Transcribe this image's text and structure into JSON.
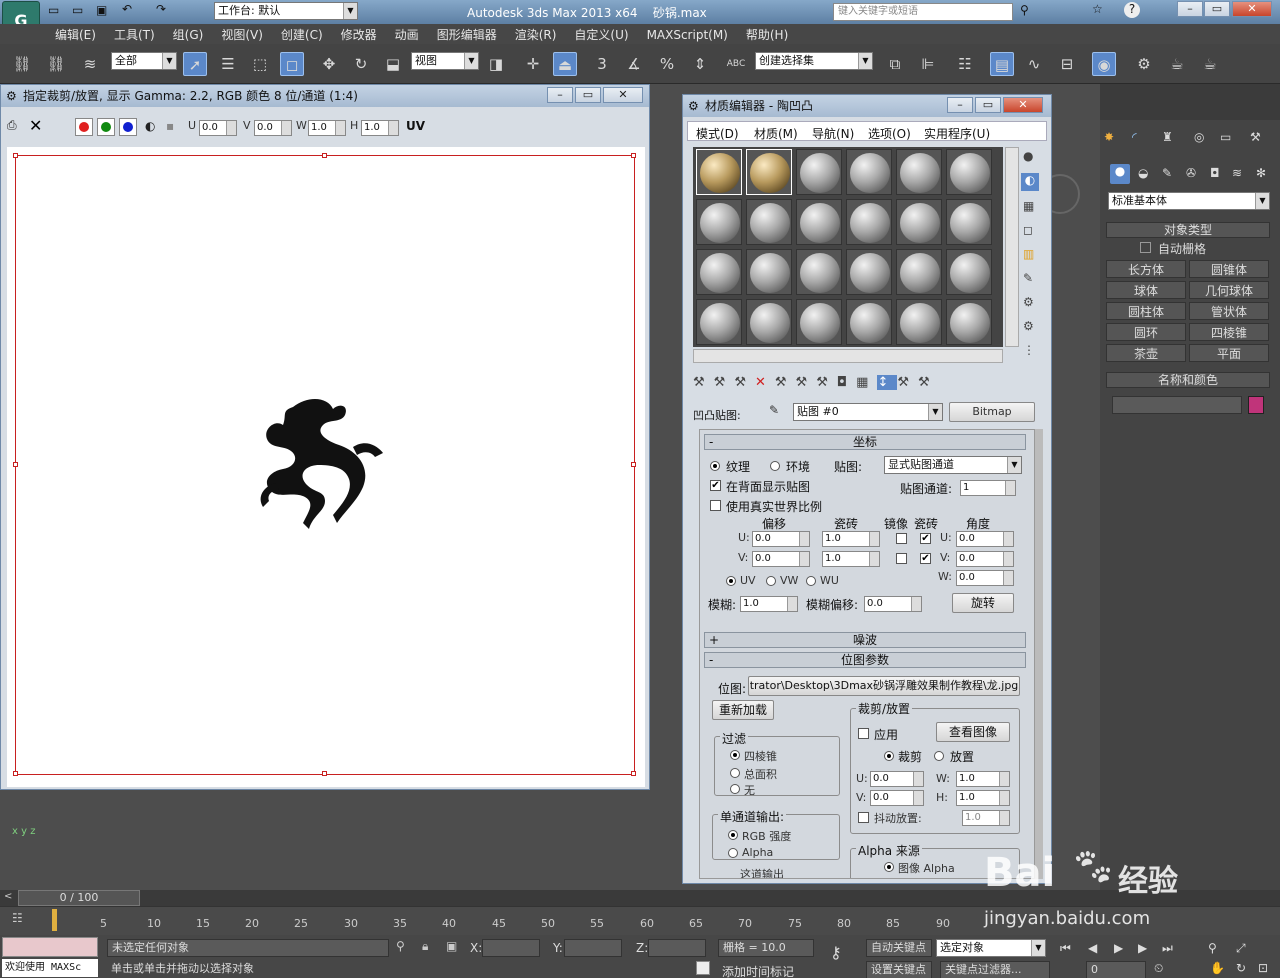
{
  "app": {
    "title": "Autodesk 3ds Max  2013 x64",
    "file": "砂锅.max",
    "workspace": "工作台: 默认",
    "search_placeholder": "键入关键字或短语"
  },
  "menu": [
    "编辑(E)",
    "工具(T)",
    "组(G)",
    "视图(V)",
    "创建(C)",
    "修改器",
    "动画",
    "图形编辑器",
    "渲染(R)",
    "自定义(U)",
    "MAXScript(M)",
    "帮助(H)"
  ],
  "toolbar": {
    "selection_filter": "全部",
    "ref_coord": "视图",
    "named_selection": "创建选择集",
    "snap3": "3",
    "snap_pct": "%",
    "abc": "ABC"
  },
  "crop_window": {
    "title": "指定裁剪/放置, 显示 Gamma: 2.2, RGB 颜色 8 位/通道 (1:4)",
    "u_label": "U",
    "u": "0.0",
    "v_label": "V",
    "v": "0.0",
    "w_label": "W",
    "w": "1.0",
    "h_label": "H",
    "h": "1.0",
    "uv_label": "UV"
  },
  "mat_editor": {
    "title": "材质编辑器 - 陶凹凸",
    "menu": [
      "模式(D)",
      "材质(M)",
      "导航(N)",
      "选项(O)",
      "实用程序(U)"
    ],
    "map_slot_label": "凹凸贴图:",
    "map_name": "贴图 #0",
    "map_type": "Bitmap",
    "coords": {
      "header": "坐标",
      "texture": "纹理",
      "env": "环境",
      "mapping_label": "贴图:",
      "mapping": "显式贴图通道",
      "show_back": "在背面显示贴图",
      "map_channel_label": "贴图通道:",
      "map_channel": "1",
      "real_world": "使用真实世界比例",
      "offset": "偏移",
      "tiling": "瓷砖",
      "mirror": "镜像",
      "tile": "瓷砖",
      "angle": "角度",
      "u": "U:",
      "v": "V:",
      "w": "W:",
      "u_offset": "0.0",
      "v_offset": "0.0",
      "u_tiling": "1.0",
      "v_tiling": "1.0",
      "u_angle": "0.0",
      "v_angle": "0.0",
      "w_angle": "0.0",
      "uv": "UV",
      "vw": "VW",
      "wu": "WU",
      "blur_label": "模糊:",
      "blur": "1.0",
      "blur_offset_label": "模糊偏移:",
      "blur_offset": "0.0",
      "rotate": "旋转"
    },
    "noise_header": "噪波",
    "bitmap": {
      "header": "位图参数",
      "path_label": "位图:",
      "path": "trator\\Desktop\\3Dmax砂锅浮雕效果制作教程\\龙.jpg",
      "reload": "重新加载",
      "filter_title": "过滤",
      "filter_opts": [
        "四棱锥",
        "总面积",
        "无"
      ],
      "mono_title": "单通道输出:",
      "mono_opts": [
        "RGB 强度",
        "Alpha"
      ],
      "crop_title": "裁剪/放置",
      "apply": "应用",
      "view_image": "查看图像",
      "crop": "裁剪",
      "place": "放置",
      "u_label": "U:",
      "u": "0.0",
      "v_label": "V:",
      "v": "0.0",
      "w_label": "W:",
      "w": "1.0",
      "h_label": "H:",
      "h": "1.0",
      "jitter": "抖动放置:",
      "jitter_val": "1.0",
      "alpha_source": "Alpha 来源",
      "alpha_opt": "图像 Alpha",
      "cutoff": "这道输出"
    }
  },
  "command_panel": {
    "category": "标准基本体",
    "object_type": "对象类型",
    "autogrid": "自动栅格",
    "objects": [
      "长方体",
      "圆锥体",
      "球体",
      "几何球体",
      "圆柱体",
      "管状体",
      "圆环",
      "四棱锥",
      "茶壶",
      "平面"
    ],
    "name_color": "名称和颜色",
    "color": "#c0347a"
  },
  "timeline": {
    "frame": "0 / 100",
    "ticks": [
      "5",
      "10",
      "15",
      "20",
      "25",
      "30",
      "35",
      "40",
      "45",
      "50",
      "55",
      "60",
      "65",
      "70",
      "75",
      "80",
      "85",
      "90"
    ]
  },
  "status": {
    "listener": "欢迎使用 MAXSc",
    "selection": "未选定任何对象",
    "prompt": "单击或单击并拖动以选择对象",
    "x": "X:",
    "y": "Y:",
    "z": "Z:",
    "grid": "栅格 = 10.0",
    "auto_key": "自动关键点",
    "set_key": "设置关键点",
    "sel_set": "选定对象",
    "key_filter": "关键点过滤器...",
    "add_tag": "添加时间标记",
    "frame_field": "0"
  },
  "watermark": {
    "brand": "Bai",
    "brand2": "经验",
    "url": "jingyan.baidu.com"
  }
}
